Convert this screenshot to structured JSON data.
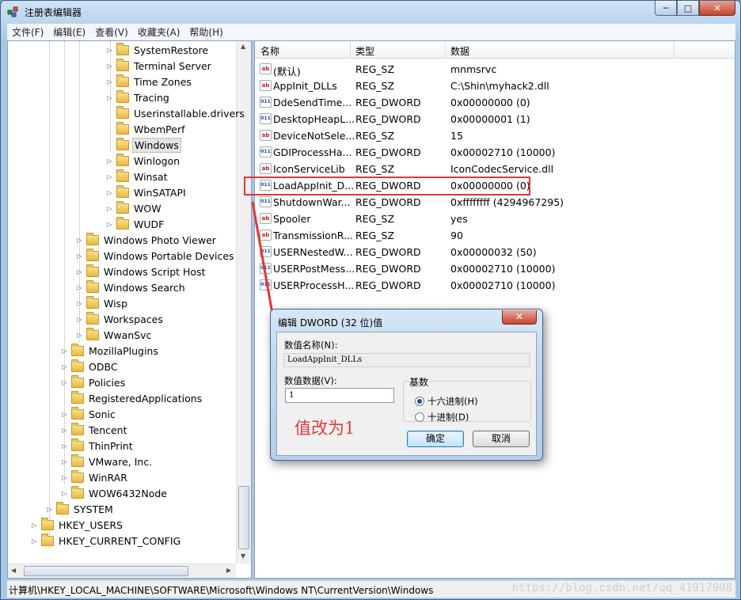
{
  "window": {
    "title": "注册表编辑器",
    "controls": {
      "minimize": "─",
      "maximize": "□",
      "close": "✕"
    }
  },
  "menubar": [
    "文件(F)",
    "编辑(E)",
    "查看(V)",
    "收藏夹(A)",
    "帮助(H)"
  ],
  "tree": {
    "items": [
      {
        "label": "SystemRestore",
        "level": 3,
        "expander": "▷"
      },
      {
        "label": "Terminal Server",
        "level": 3,
        "expander": "▷"
      },
      {
        "label": "Time Zones",
        "level": 3,
        "expander": "▷"
      },
      {
        "label": "Tracing",
        "level": 3,
        "expander": "▷"
      },
      {
        "label": "Userinstallable.drivers",
        "level": 3,
        "expander": ""
      },
      {
        "label": "WbemPerf",
        "level": 3,
        "expander": ""
      },
      {
        "label": "Windows",
        "level": 3,
        "expander": "",
        "selected": true
      },
      {
        "label": "Winlogon",
        "level": 3,
        "expander": "▷"
      },
      {
        "label": "Winsat",
        "level": 3,
        "expander": "▷"
      },
      {
        "label": "WinSATAPI",
        "level": 3,
        "expander": "▷"
      },
      {
        "label": "WOW",
        "level": 3,
        "expander": "▷"
      },
      {
        "label": "WUDF",
        "level": 3,
        "expander": "▷"
      },
      {
        "label": "Windows Photo Viewer",
        "level": 2,
        "expander": "▷"
      },
      {
        "label": "Windows Portable Devices",
        "level": 2,
        "expander": "▷"
      },
      {
        "label": "Windows Script Host",
        "level": 2,
        "expander": "▷"
      },
      {
        "label": "Windows Search",
        "level": 2,
        "expander": "▷"
      },
      {
        "label": "Wisp",
        "level": 2,
        "expander": "▷"
      },
      {
        "label": "Workspaces",
        "level": 2,
        "expander": "▷"
      },
      {
        "label": "WwanSvc",
        "level": 2,
        "expander": "▷"
      },
      {
        "label": "MozillaPlugins",
        "level": 1,
        "expander": "▷"
      },
      {
        "label": "ODBC",
        "level": 1,
        "expander": "▷"
      },
      {
        "label": "Policies",
        "level": 1,
        "expander": "▷"
      },
      {
        "label": "RegisteredApplications",
        "level": 1,
        "expander": ""
      },
      {
        "label": "Sonic",
        "level": 1,
        "expander": "▷"
      },
      {
        "label": "Tencent",
        "level": 1,
        "expander": "▷"
      },
      {
        "label": "ThinPrint",
        "level": 1,
        "expander": "▷"
      },
      {
        "label": "VMware, Inc.",
        "level": 1,
        "expander": "▷"
      },
      {
        "label": "WinRAR",
        "level": 1,
        "expander": "▷"
      },
      {
        "label": "WOW6432Node",
        "level": 1,
        "expander": "▷"
      },
      {
        "label": "SYSTEM",
        "level": 0,
        "expander": "▷"
      },
      {
        "label": "HKEY_USERS",
        "level": -1,
        "expander": "▷"
      },
      {
        "label": "HKEY_CURRENT_CONFIG",
        "level": -1,
        "expander": "▷"
      }
    ]
  },
  "list": {
    "headers": {
      "name": "名称",
      "type": "类型",
      "data": "数据"
    },
    "rows": [
      {
        "icon": "string-value-icon",
        "name": "(默认)",
        "type": "REG_SZ",
        "data": "mnmsrvc"
      },
      {
        "icon": "string-value-icon",
        "name": "AppInit_DLLs",
        "type": "REG_SZ",
        "data": "C:\\Shin\\myhack2.dll"
      },
      {
        "icon": "dword-value-icon",
        "name": "DdeSendTime...",
        "type": "REG_DWORD",
        "data": "0x00000000 (0)"
      },
      {
        "icon": "dword-value-icon",
        "name": "DesktopHeapL...",
        "type": "REG_DWORD",
        "data": "0x00000001 (1)"
      },
      {
        "icon": "string-value-icon",
        "name": "DeviceNotSele...",
        "type": "REG_SZ",
        "data": "15"
      },
      {
        "icon": "dword-value-icon",
        "name": "GDIProcessHa...",
        "type": "REG_DWORD",
        "data": "0x00002710 (10000)"
      },
      {
        "icon": "string-value-icon",
        "name": "IconServiceLib",
        "type": "REG_SZ",
        "data": "IconCodecService.dll"
      },
      {
        "icon": "dword-value-icon",
        "name": "LoadAppInit_D...",
        "type": "REG_DWORD",
        "data": "0x00000000 (0)"
      },
      {
        "icon": "dword-value-icon",
        "name": "ShutdownWar...",
        "type": "REG_DWORD",
        "data": "0xffffffff (4294967295)"
      },
      {
        "icon": "string-value-icon",
        "name": "Spooler",
        "type": "REG_SZ",
        "data": "yes"
      },
      {
        "icon": "string-value-icon",
        "name": "TransmissionR...",
        "type": "REG_SZ",
        "data": "90"
      },
      {
        "icon": "dword-value-icon",
        "name": "USERNestedW...",
        "type": "REG_DWORD",
        "data": "0x00000032 (50)"
      },
      {
        "icon": "dword-value-icon",
        "name": "USERPostMess...",
        "type": "REG_DWORD",
        "data": "0x00002710 (10000)"
      },
      {
        "icon": "dword-value-icon",
        "name": "USERProcessH...",
        "type": "REG_DWORD",
        "data": "0x00002710 (10000)"
      }
    ],
    "icon_text": {
      "string": "ab",
      "dword": "011\n110"
    }
  },
  "dialog": {
    "title": "编辑 DWORD (32 位)值",
    "close": "✕",
    "name_label": "数值名称(N):",
    "name_value": "LoadAppInit_DLLs",
    "data_label": "数值数据(V):",
    "data_value": "1",
    "base_label": "基数",
    "hex_label": "十六进制(H)",
    "dec_label": "十进制(D)",
    "hex_selected": true,
    "ok_label": "确定",
    "cancel_label": "取消"
  },
  "annotation": {
    "text": "值改为1",
    "color": "#e03a3a"
  },
  "statusbar": {
    "path": "计算机\\HKEY_LOCAL_MACHINE\\SOFTWARE\\Microsoft\\Windows NT\\CurrentVersion\\Windows"
  },
  "watermark": "https://blog.csdn.net/qq_41917908",
  "colors": {
    "accent": "#3c7fb1",
    "highlight_box": "#e53535",
    "close_button": "#c24530"
  }
}
